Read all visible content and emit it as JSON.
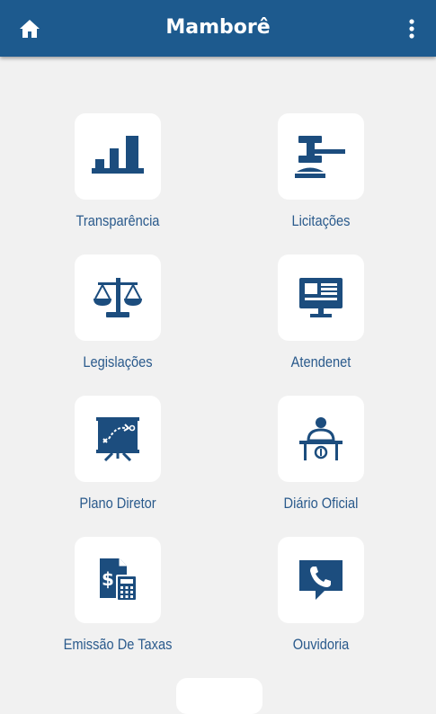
{
  "app": {
    "title": "Mamborê",
    "accent_color": "#1d5a8e",
    "icon_color": "#1c4d7e",
    "label_color": "#2a5a8c"
  },
  "appbar": {
    "home_icon": "home-icon",
    "menu_icon": "more-vertical-icon"
  },
  "tiles": [
    {
      "label": "Transparência",
      "icon": "bar-chart-icon"
    },
    {
      "label": "Licitações",
      "icon": "gavel-icon"
    },
    {
      "label": "Legislações",
      "icon": "scales-icon"
    },
    {
      "label": "Atendenet",
      "icon": "monitor-news-icon"
    },
    {
      "label": "Plano Diretor",
      "icon": "strategy-board-icon"
    },
    {
      "label": "Diário Oficial",
      "icon": "official-desk-icon"
    },
    {
      "label": "Emissão De Taxas",
      "icon": "tax-calculator-icon"
    },
    {
      "label": "Ouvidoria",
      "icon": "phone-chat-icon"
    }
  ]
}
